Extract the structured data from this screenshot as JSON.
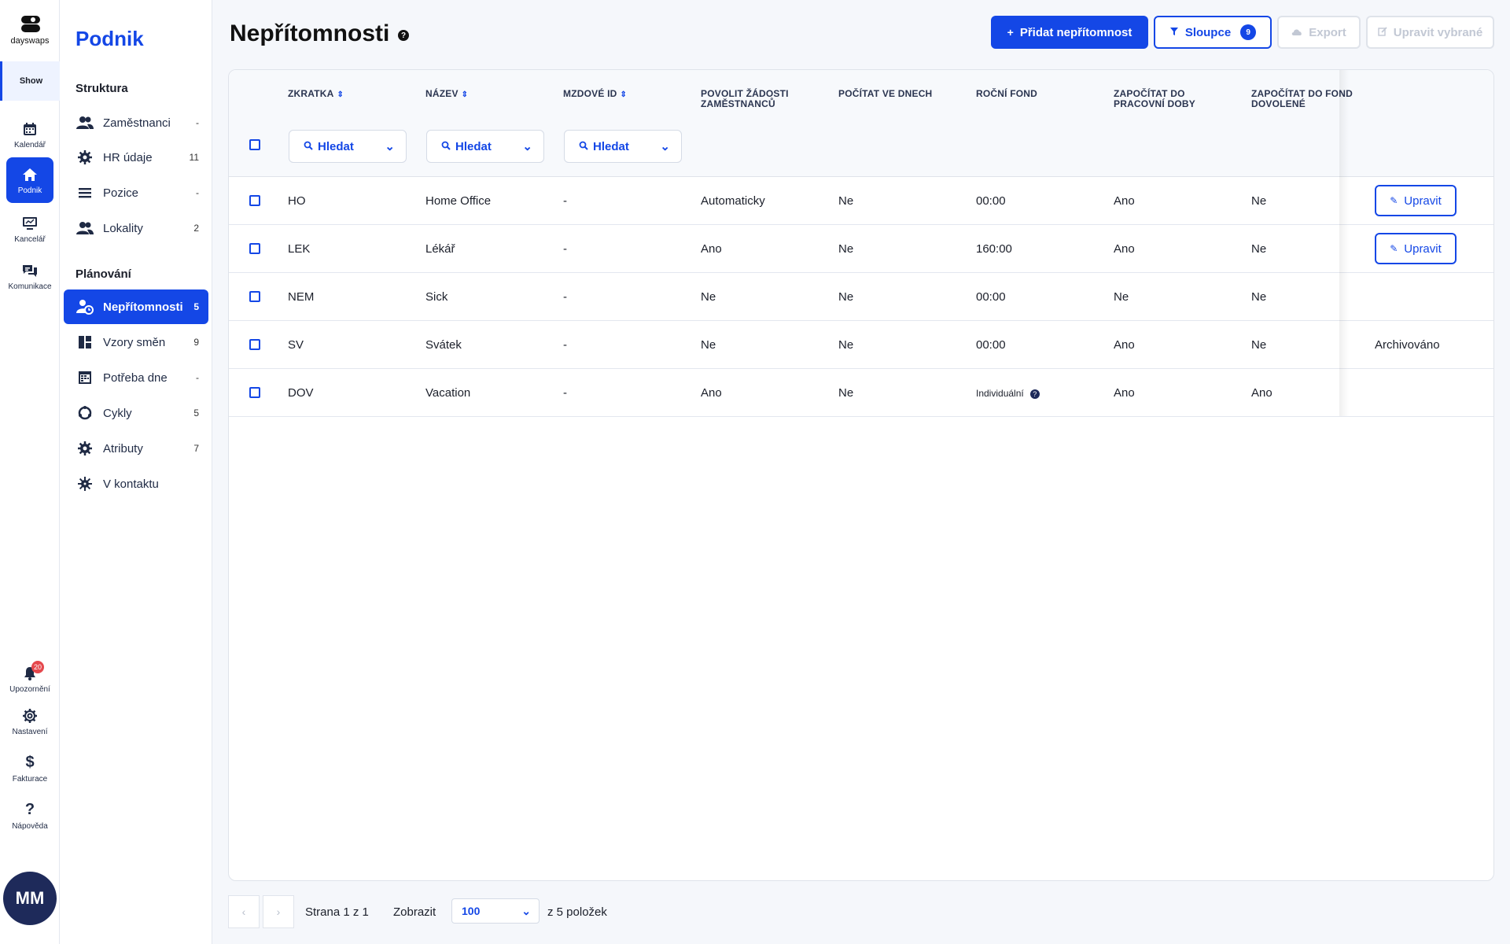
{
  "app": {
    "logo_text": "dayswaps",
    "show_label": "Show"
  },
  "rail": {
    "items": [
      {
        "label": "Kalendář",
        "icon": "calendar-icon"
      },
      {
        "label": "Podnik",
        "icon": "home-icon"
      },
      {
        "label": "Kancelář",
        "icon": "monitor-icon"
      },
      {
        "label": "Komunikace",
        "icon": "chat-icon"
      }
    ],
    "bottom": [
      {
        "label": "Upozornění",
        "icon": "bell-icon",
        "badge": "20"
      },
      {
        "label": "Nastavení",
        "icon": "gear-icon"
      },
      {
        "label": "Fakturace",
        "icon": "dollar-icon"
      },
      {
        "label": "Nápověda",
        "icon": "question-icon"
      }
    ],
    "avatar": "MM"
  },
  "sidebar": {
    "title": "Podnik",
    "sections": [
      {
        "title": "Struktura",
        "items": [
          {
            "label": "Zaměstnanci",
            "count": "-",
            "icon": "people-icon"
          },
          {
            "label": "HR údaje",
            "count": "11",
            "icon": "gear-badge-icon"
          },
          {
            "label": "Pozice",
            "count": "-",
            "icon": "list-icon"
          },
          {
            "label": "Lokality",
            "count": "2",
            "icon": "people-icon"
          }
        ]
      },
      {
        "title": "Plánování",
        "items": [
          {
            "label": "Nepřítomnosti",
            "count": "5",
            "icon": "person-clock-icon"
          },
          {
            "label": "Vzory směn",
            "count": "9",
            "icon": "grid-icon"
          },
          {
            "label": "Potřeba dne",
            "count": "-",
            "icon": "calendar-grid-icon"
          },
          {
            "label": "Cykly",
            "count": "5",
            "icon": "cycle-icon"
          },
          {
            "label": "Atributy",
            "count": "7",
            "icon": "gear-badge-icon"
          },
          {
            "label": "V kontaktu",
            "count": "",
            "icon": "virus-icon"
          }
        ]
      }
    ]
  },
  "header": {
    "title": "Nepřítomnosti",
    "help": "?",
    "add_label": "Přidat nepřítomnost",
    "columns_label": "Sloupce",
    "columns_count": "9",
    "export_label": "Export",
    "edit_selected_label": "Upravit vybrané"
  },
  "table": {
    "columns": [
      {
        "label": "ZKRATKA",
        "sortable": true
      },
      {
        "label": "NÁZEV",
        "sortable": true
      },
      {
        "label": "MZDOVÉ ID",
        "sortable": true
      },
      {
        "label": "POVOLIT ŽÁDOSTI ZAMĚSTNANCŮ",
        "line1": "POVOLIT ŽÁDOSTI",
        "line2": "ZAMĚSTNANCŮ"
      },
      {
        "label": "POČÍTAT VE DNECH"
      },
      {
        "label": "ROČNÍ FOND"
      },
      {
        "label": "ZAPOČÍTAT DO PRACOVNÍ DOBY",
        "line1": "ZAPOČÍTAT DO",
        "line2": "PRACOVNÍ DOBY"
      },
      {
        "label": "ZAPOČÍTAT DO FOND DOVOLENÉ",
        "line1": "ZAPOČÍTAT DO FOND",
        "line2": "DOVOLENÉ"
      }
    ],
    "filter_placeholder": "Hledat",
    "rows": [
      {
        "code": "HO",
        "name": "Home Office",
        "payroll": "-",
        "requests": "Automaticky",
        "days": "Ne",
        "fund": "00:00",
        "work": "Ano",
        "vacation": "Ne",
        "action": "Upravit"
      },
      {
        "code": "LEK",
        "name": "Lékář",
        "payroll": "-",
        "requests": "Ano",
        "days": "Ne",
        "fund": "160:00",
        "work": "Ano",
        "vacation": "Ne",
        "action": "Upravit"
      },
      {
        "code": "NEM",
        "name": "Sick",
        "payroll": "-",
        "requests": "Ne",
        "days": "Ne",
        "fund": "00:00",
        "work": "Ne",
        "vacation": "Ne",
        "action": ""
      },
      {
        "code": "SV",
        "name": "Svátek",
        "payroll": "-",
        "requests": "Ne",
        "days": "Ne",
        "fund": "00:00",
        "work": "Ano",
        "vacation": "Ne",
        "action": "Archivováno"
      },
      {
        "code": "DOV",
        "name": "Vacation",
        "payroll": "-",
        "requests": "Ano",
        "days": "Ne",
        "fund": "Individuální",
        "work": "Ano",
        "vacation": "Ano",
        "action": ""
      }
    ]
  },
  "pager": {
    "page_text": "Strana 1 z 1",
    "show_label": "Zobrazit",
    "page_size": "100",
    "total_text": "z 5 položek"
  },
  "colors": {
    "accent": "#1447e6",
    "badge": "#e5484d",
    "avatar": "#1e2a5a"
  }
}
